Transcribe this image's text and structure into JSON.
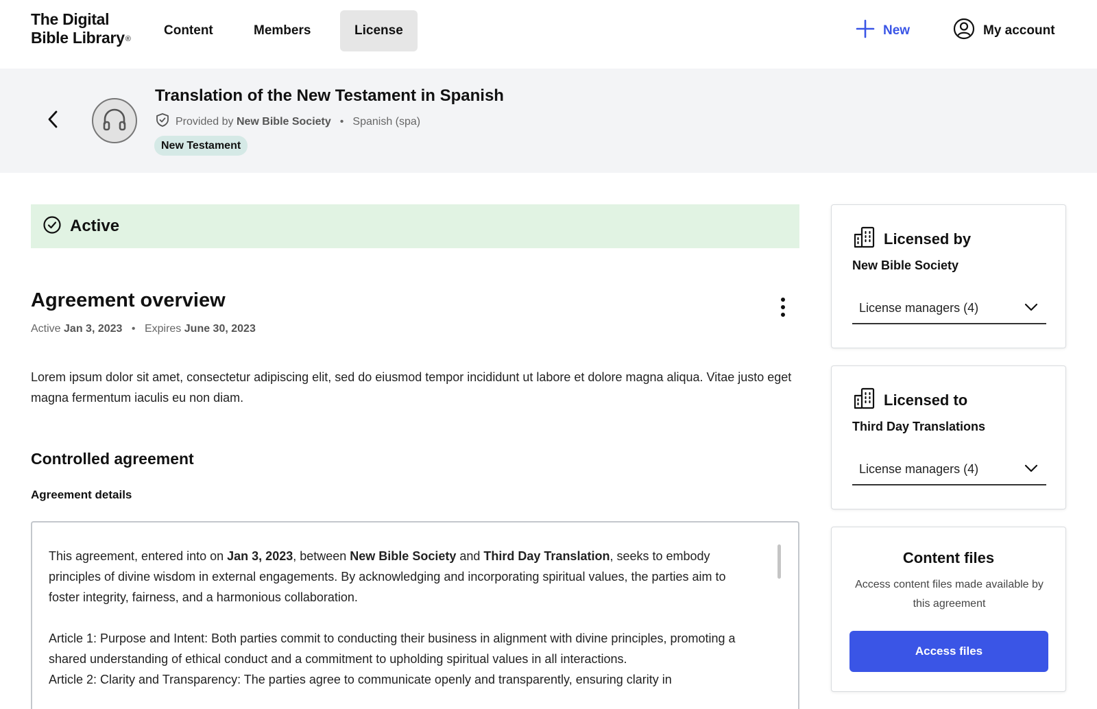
{
  "logo": {
    "line1": "The Digital",
    "line2": "Bible Library",
    "reg": "®"
  },
  "nav": {
    "items": [
      {
        "label": "Content"
      },
      {
        "label": "Members"
      },
      {
        "label": "License"
      }
    ],
    "new_label": "New",
    "account_label": "My account"
  },
  "header": {
    "title": "Translation of the New Testament in Spanish",
    "provided_prefix": "Provided by",
    "provider": "New Bible Society",
    "separator": "•",
    "language": "Spanish (spa)",
    "tag": "New Testament",
    "media_icon": "headphones-icon"
  },
  "status": {
    "label": "Active",
    "color": "#e1f3e3"
  },
  "overview": {
    "title": "Agreement overview",
    "active_prefix": "Active",
    "active_date": "Jan 3, 2023",
    "separator": "•",
    "expires_prefix": "Expires",
    "expires_date": "June 30, 2023",
    "description": "Lorem ipsum dolor sit amet, consectetur adipiscing elit, sed do eiusmod tempor incididunt ut labore et dolore magna aliqua. Vitae justo eget magna fermentum iaculis eu non diam."
  },
  "controlled": {
    "title": "Controlled agreement",
    "details_label": "Agreement details",
    "p1": {
      "a": "This agreement, entered into on ",
      "date": "Jan 3, 2023",
      "b": ", between ",
      "party1": "New Bible Society",
      "c": " and ",
      "party2": "Third Day Translation",
      "d": ", seeks to embody principles of divine wisdom in external engagements. By acknowledging and incorporating spiritual values, the parties aim to foster integrity, fairness, and a harmonious collaboration."
    },
    "article1": "Article 1: Purpose and Intent: Both parties commit to conducting their business in alignment with divine principles, promoting a shared understanding of ethical conduct and a commitment to upholding spiritual values in all interactions.",
    "article2": "Article 2: Clarity and Transparency: The parties agree to communicate openly and transparently, ensuring clarity in"
  },
  "licensed_by": {
    "title": "Licensed by",
    "org": "New Bible Society",
    "managers": "License managers (4)"
  },
  "licensed_to": {
    "title": "Licensed to",
    "org": "Third Day Translations",
    "managers": "License managers (4)"
  },
  "content_files": {
    "title": "Content files",
    "description": "Access content files made available by this agreement",
    "button": "Access files"
  },
  "colors": {
    "accent": "#3a55e6",
    "tag_bg": "#d5e9e6",
    "header_bg": "#f3f4f6"
  }
}
